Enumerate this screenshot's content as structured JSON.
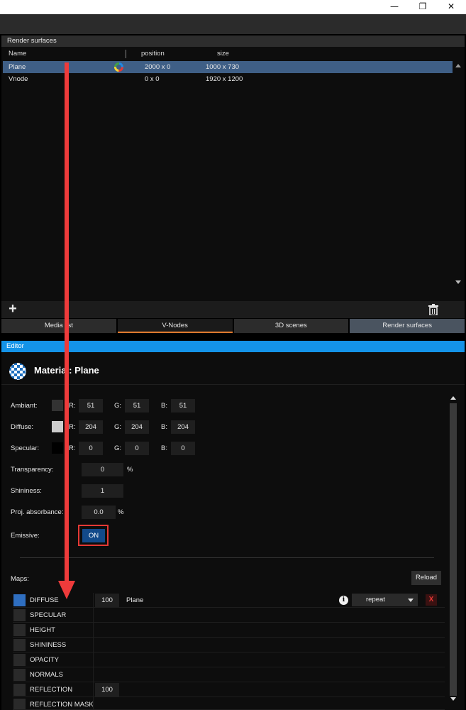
{
  "window": {
    "minimize_glyph": "—",
    "restore_glyph": "❐",
    "close_glyph": "✕"
  },
  "render_surfaces": {
    "title": "Render surfaces",
    "columns": {
      "name": "Name",
      "position": "position",
      "size": "size"
    },
    "rows": [
      {
        "name": "Plane",
        "position": "2000 x 0",
        "size": "1000 x 730",
        "selected": true,
        "icon": "color-wheel-icon"
      },
      {
        "name": "Vnode",
        "position": "0 x 0",
        "size": "1920 x 1200",
        "selected": false
      }
    ],
    "add_glyph": "+",
    "delete_icon": "trash-icon"
  },
  "tabs": [
    {
      "label": "Media list"
    },
    {
      "label": "V-Nodes",
      "active": true
    },
    {
      "label": "3D scenes"
    },
    {
      "label": "Render surfaces",
      "selected": true
    }
  ],
  "editor": {
    "title": "Editor",
    "material_title": "Material: Plane",
    "ambiant": {
      "label": "Ambiant:",
      "r": "51",
      "g": "51",
      "b": "51",
      "color": "#333333"
    },
    "diffuse": {
      "label": "Diffuse:",
      "r": "204",
      "g": "204",
      "b": "204",
      "color": "#cccccc"
    },
    "specular": {
      "label": "Specular:",
      "r": "0",
      "g": "0",
      "b": "0",
      "color": "#000000"
    },
    "channel_labels": {
      "r": "R:",
      "g": "G:",
      "b": "B:"
    },
    "transparency": {
      "label": "Transparency:",
      "value": "0",
      "unit": "%"
    },
    "shininess": {
      "label": "Shininess:",
      "value": "1"
    },
    "proj_absorbance": {
      "label": "Proj. absorbance:",
      "value": "0.0",
      "unit": "%"
    },
    "emissive": {
      "label": "Emissive:",
      "value": "ON"
    },
    "maps_label": "Maps:",
    "reload_label": "Reload",
    "maps": [
      {
        "name": "DIFFUSE",
        "enabled": true,
        "value": "100",
        "file": "Plane",
        "wrap": "repeat",
        "remove": "X"
      },
      {
        "name": "SPECULAR"
      },
      {
        "name": "HEIGHT"
      },
      {
        "name": "SHININESS"
      },
      {
        "name": "OPACITY"
      },
      {
        "name": "NORMALS"
      },
      {
        "name": "REFLECTION",
        "value": "100"
      },
      {
        "name": "REFLECTION MASK"
      }
    ]
  },
  "colors": {
    "accent": "#1493e8",
    "selection": "#3f5f86",
    "tab_underline": "#e07a2e",
    "annotation_red": "#ee3b3b"
  }
}
